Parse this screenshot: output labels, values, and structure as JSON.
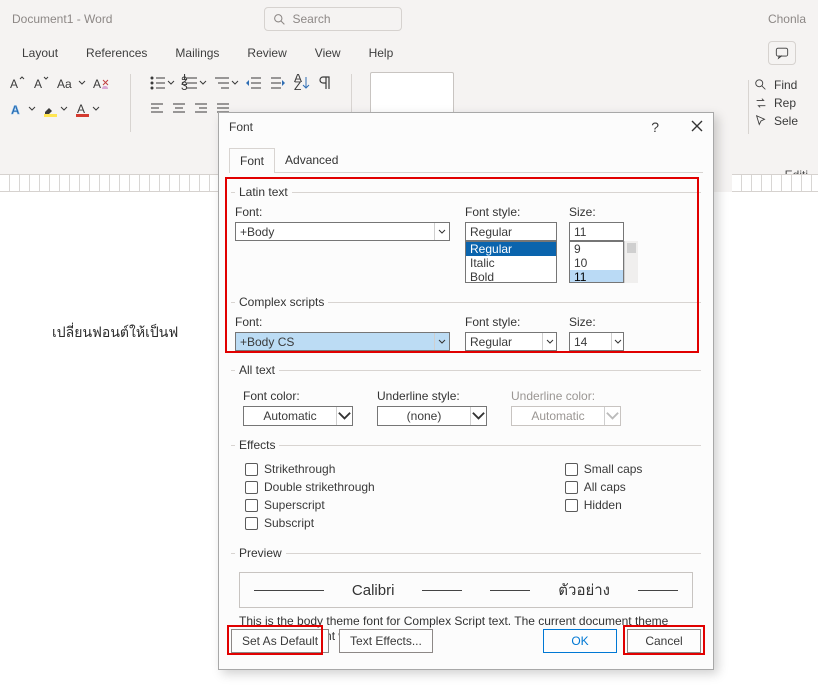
{
  "window": {
    "title": "Document1  -  Word",
    "user": "Chonla"
  },
  "search": {
    "placeholder": "Search"
  },
  "menu": {
    "layout": "Layout",
    "references": "References",
    "mailings": "Mailings",
    "review": "Review",
    "view": "View",
    "help": "Help"
  },
  "editing_pane": {
    "find": "Find",
    "replace": "Rep",
    "select": "Sele",
    "label": "Editi"
  },
  "doc": {
    "body": "เปลี่ยนฟอนต์ให้เป็นฟ"
  },
  "dialog": {
    "title": "Font",
    "tabs": {
      "font": "Font",
      "advanced": "Advanced"
    },
    "latin": {
      "legend": "Latin text",
      "font_label": "Font:",
      "font_value": "+Body",
      "style_label": "Font style:",
      "style_value": "Regular",
      "style_options": [
        "Regular",
        "Italic",
        "Bold"
      ],
      "size_label": "Size:",
      "size_value": "11",
      "size_options": [
        "9",
        "10",
        "11"
      ]
    },
    "complex": {
      "legend": "Complex scripts",
      "font_label": "Font:",
      "font_value": "+Body CS",
      "style_label": "Font style:",
      "style_value": "Regular",
      "size_label": "Size:",
      "size_value": "14"
    },
    "alltext": {
      "legend": "All text",
      "fontcolor_label": "Font color:",
      "fontcolor_value": "Automatic",
      "underline_label": "Underline style:",
      "underline_value": "(none)",
      "ucolor_label": "Underline color:",
      "ucolor_value": "Automatic"
    },
    "effects": {
      "legend": "Effects",
      "left": [
        "Strikethrough",
        "Double strikethrough",
        "Superscript",
        "Subscript"
      ],
      "right": [
        "Small caps",
        "All caps",
        "Hidden"
      ]
    },
    "preview": {
      "legend": "Preview",
      "latin": "Calibri",
      "thai": "ตัวอย่าง"
    },
    "desc": "This is the body theme font for Complex Script text. The current document theme defines which font will be used.",
    "buttons": {
      "default": "Set As Default",
      "text_effects": "Text Effects...",
      "ok": "OK",
      "cancel": "Cancel"
    }
  }
}
